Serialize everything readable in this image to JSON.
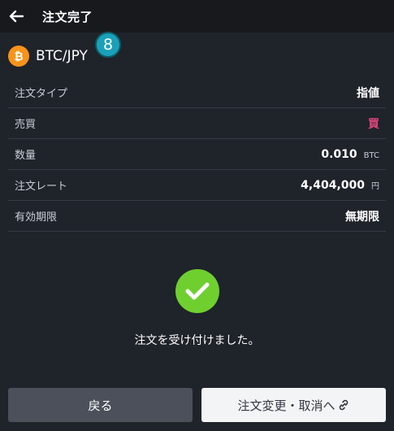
{
  "header": {
    "title": "注文完了"
  },
  "pair": {
    "label": "BTC/JPY",
    "step_badge": "8"
  },
  "rows": [
    {
      "label": "注文タイプ",
      "value": "指値",
      "unit": ""
    },
    {
      "label": "売買",
      "value": "買",
      "unit": ""
    },
    {
      "label": "数量",
      "value": "0.010",
      "unit": "BTC"
    },
    {
      "label": "注文レート",
      "value": "4,404,000",
      "unit": "円"
    },
    {
      "label": "有効期限",
      "value": "無期限",
      "unit": ""
    }
  ],
  "message": "注文を受け付けました。",
  "buttons": {
    "back": "戻る",
    "change_cancel": "注文変更・取消へ"
  },
  "colors": {
    "buy": "#e0457b",
    "success": "#6fcf2f",
    "btc": "#f7931a",
    "badge": "#1aa0b8"
  },
  "icons": {
    "back": "arrow-left-icon",
    "coin": "bitcoin-icon",
    "success": "check-circle-icon",
    "link": "link-icon"
  }
}
